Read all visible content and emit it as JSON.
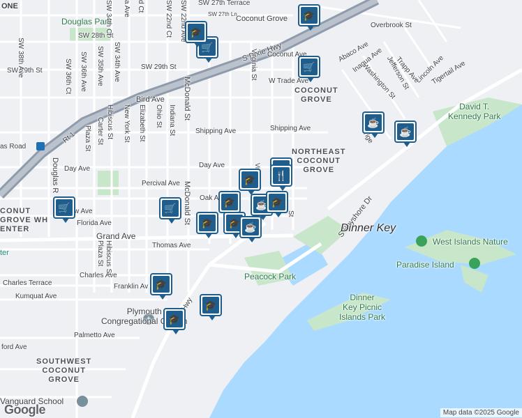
{
  "colors": {
    "water": "#aadaff",
    "park": "#c8e6c9",
    "road": "#ffffff",
    "highway": "#8f9bab",
    "pin": "#1e5d8c",
    "land": "#eef0f3"
  },
  "labels": {
    "coconut_grove_top": "Coconut Grove",
    "douglas_park": "Douglas Park",
    "sw_27th_terrace": "SW 27th Terrace",
    "sw_27th_ln": "SW 27th Ln",
    "sw_28th_st": "SW 28th St",
    "sw_29th_st": "SW 29th St",
    "sw_29th_st_2": "SW 29th St",
    "overbrook_st": "Overbrook St",
    "s_dixie_hwy": "S Dixie Hwy",
    "coconut_ave": "Coconut Ave",
    "w_trade_ave": "W Trade Ave",
    "bird_ave": "Bird Ave",
    "shipping_ave_w": "Shipping Ave",
    "shipping_ave_e": "Shipping Ave",
    "day_ave": "Day Ave",
    "percival_ave": "Percival Ave",
    "oak_ave": "Oak Av",
    "florida_ave": "Florida Ave",
    "grand_ave": "Grand Ave",
    "thomas_ave": "Thomas Ave",
    "charles_ave": "Charles Ave",
    "charles_terrace": "Charles Terrace",
    "franklin_ave": "Franklin Av",
    "kumquat_ave": "Kumquat Ave",
    "palmetto_ave": "Palmetto Ave",
    "ford_ave": "ford Ave",
    "ew_ave": "w Ave",
    "as_road": "as Road",
    "rt1": "Rt 1",
    "hwy": "Hwy",
    "tigertail_ave": "Tigertail Ave",
    "lincoln_ave": "Lincoln Ave",
    "trapp_ave": "Trapp Ave",
    "jefferson_st": "Jefferson St",
    "washington_st": "Washington St",
    "abaco_ave": "Abaco Ave",
    "inagua_ave": "Inagua Ave",
    "s_bayshore_dr": "S Bayshore Dr",
    "tige": "Tige",
    "mcdonald_st": "McDonald St",
    "mcdonald_st_2": "McDonald St",
    "virginia_st": "Virginia St",
    "indiana_st": "Indiana St",
    "ohio_st": "Ohio St",
    "elizabeth_st": "Elizabeth St",
    "new_york_st": "New York St",
    "hibiscus_st": "Hibiscus St",
    "hibiscus_st_2": "Hibiscus St",
    "carter_st": "Carter St",
    "plaza_st": "Plaza St",
    "plaza_st_2": "Plaza St",
    "sw_34th_ave": "SW 34th Ave",
    "sw_35th_ave": "SW 35th Ave",
    "sw_36th_ave": "SW 36th Ave",
    "sw_36th_ct": "SW 36th Ct",
    "sw_38th_ave": "SW 38th Ave",
    "sw_34th_ct": "SW 34th Ct",
    "d_ct": "d Ct",
    "sw_22nd_ct": "SW 22nd Ct",
    "sw_22nd_ave": "SW 22nd Ave",
    "a_ave": "a Ave",
    "douglas_rd": "Douglas R",
    "st_label": "St",
    "vir": "Vir",
    "coconut_grove_hood": "COCONUT\nGROVE",
    "northeast_coconut_grove": "NORTHEAST\nCOCONUT\nGROVE",
    "southwest_coconut_grove": "SOUTHWEST\nCOCONUT\nGROVE",
    "one": "ONE",
    "coconut_grove_wh_center": "CONUT\nGROVE WH\nENTER",
    "ter": "ter",
    "dinner_key": "Dinner Key",
    "peacock_park": "Peacock Park",
    "david_kennedy_park": "David T.\nKennedy Park",
    "west_islands_nature": "West Islands Nature",
    "paradise_island": "Paradise Island",
    "dinner_key_picnic": "Dinner\nKey Picnic\nIslands Park",
    "plymouth_church": "Plymouth\nCongregational Church",
    "vanguard_school": "Vanguard School"
  },
  "pins": [
    {
      "type": "school",
      "glyph": "🎓"
    },
    {
      "type": "shopping",
      "glyph": "🛒"
    },
    {
      "type": "school",
      "glyph": "🎓"
    },
    {
      "type": "shopping",
      "glyph": "🛒"
    },
    {
      "type": "cafe",
      "glyph": "☕"
    },
    {
      "type": "cafe",
      "glyph": "☕"
    },
    {
      "type": "shopping",
      "glyph": "🛒"
    },
    {
      "type": "shopping",
      "glyph": "🛒"
    },
    {
      "type": "school",
      "glyph": "🎓"
    },
    {
      "type": "school",
      "glyph": "🎓"
    },
    {
      "type": "cafe",
      "glyph": "☕"
    },
    {
      "type": "school",
      "glyph": "🎓"
    },
    {
      "type": "school",
      "glyph": "🎓"
    },
    {
      "type": "school",
      "glyph": "🎓"
    },
    {
      "type": "school",
      "glyph": "🎓"
    },
    {
      "type": "cafe",
      "glyph": "☕"
    },
    {
      "type": "school",
      "glyph": "🎓"
    },
    {
      "type": "restaurant",
      "glyph": "🍴"
    },
    {
      "type": "school",
      "glyph": "🎓"
    }
  ],
  "attribution": {
    "logo": "Google",
    "map_data": "Map data ©2025 Google"
  }
}
